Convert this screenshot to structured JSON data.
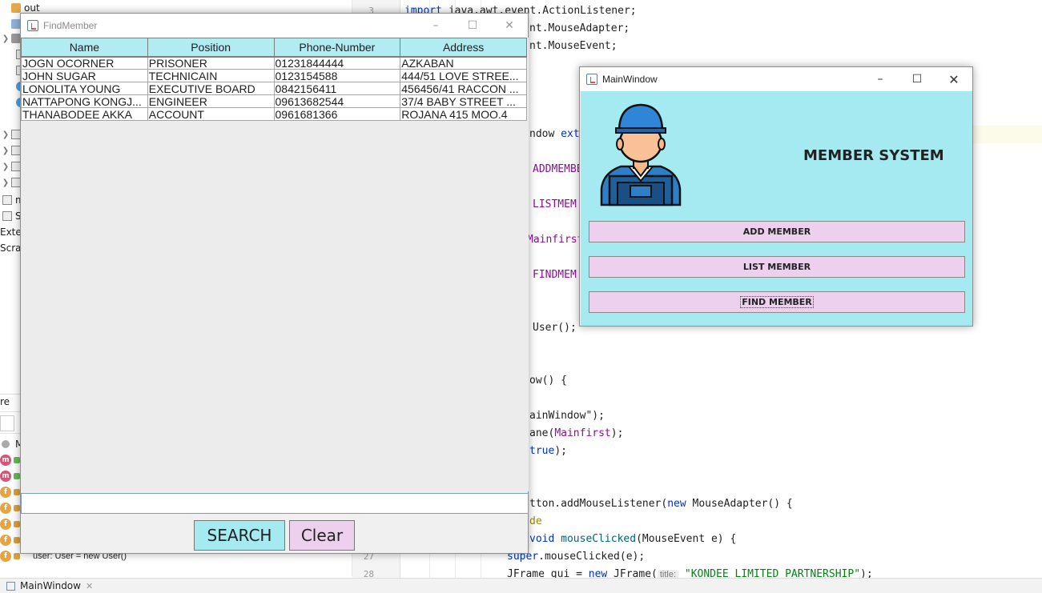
{
  "ide": {
    "tree": [
      {
        "label": "out",
        "icon": "folder-icon"
      },
      {
        "label": "s",
        "icon": "folder-icon"
      },
      {
        "label": "",
        "icon": "folder-icon"
      },
      {
        "label": "m",
        "icon": "module-icon"
      },
      {
        "label": "S",
        "icon": "library-icon"
      },
      {
        "label": "Exter",
        "icon": "library-icon"
      },
      {
        "label": "Scrat",
        "icon": "scratch-icon"
      }
    ],
    "structure_header": "re",
    "structure_item_label": "M",
    "structure_field": "user: User = new User()",
    "line_numbers": [
      "3",
      "27",
      "28"
    ],
    "code": {
      "l1_kw": "import",
      "l1_rest": " java.awt.event.ActionListener;",
      "l2": "nt.MouseAdapter;",
      "l3": "nt.MouseEvent;",
      "l4_a": "ndow ",
      "l4_kw": "exte",
      "l5": "ADDMEMBE",
      "l6": "LISTMEM",
      "l7": "Mainfirst",
      "l8": "FINDMEM",
      "l9": "User();",
      "l10": "ow() {",
      "l11": "ainWindow\");",
      "l12_a": "ane(",
      "l12_fld": "Mainfirst",
      "l12_b": ");",
      "l13_kw": "true",
      "l13_b": ");",
      "l14_a": "tton.addMouseListener(",
      "l14_kw": "new",
      "l14_b": " MouseAdapter() {",
      "l15": "de",
      "l16_a": "void ",
      "l16_m": "mouseClicked",
      "l16_b": "(MouseEvent e) {",
      "l17_kw": "super",
      "l17_b": ".mouseClicked(e);",
      "l18_a": "JFrame gui = ",
      "l18_kw": "new",
      "l18_b": " JFrame(",
      "l18_hint": "title:",
      "l18_str": "\"KONDEE LIMITED PARTNERSHIP\"",
      "l18_c": ");"
    },
    "status_tab": "MainWindow"
  },
  "find_member": {
    "title": "FindMember",
    "columns": [
      "Name",
      "Position",
      "Phone-Number",
      "Address"
    ],
    "rows": [
      [
        "JOGN OCORNER",
        "PRISONER",
        "01231844444",
        "AZKABAN"
      ],
      [
        "JOHN SUGAR",
        "TECHNICAIN",
        "0123154588",
        "444/51 LOVE STREE..."
      ],
      [
        "LONOLITA YOUNG",
        "EXECUTIVE BOARD",
        "0842156411",
        "456456/41 RACCON ..."
      ],
      [
        "NATTAPONG KONGJ...",
        "ENGINEER",
        "09613682544",
        "37/4 BABY STREET ..."
      ],
      [
        "THANABODEE AKKA",
        "ACCOUNT",
        "0961681366",
        "ROJANA 415 MOO.4"
      ]
    ],
    "search_value": "",
    "search_label": "SEARCH",
    "clear_label": "Clear",
    "search_color": "#a6eaf1",
    "clear_color": "#edcfee"
  },
  "main_window": {
    "title": "MainWindow",
    "heading": "MEMBER SYSTEM",
    "avatar_icon": "worker-avatar-icon",
    "buttons": {
      "add": "ADD MEMBER",
      "list": "LIST MEMBER",
      "find": "FIND MEMBER"
    },
    "bg_color": "#a6eaf1",
    "button_color": "#edcfee"
  }
}
